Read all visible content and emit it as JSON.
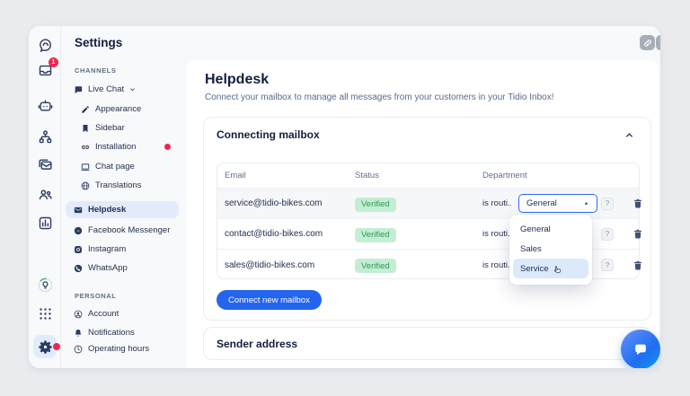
{
  "theme": {
    "accent": "#2465f0",
    "badge_red": "#f3264b",
    "verified_bg": "#c4eed3",
    "verified_text": "#2e9857",
    "selected_bg": "#e2ebfc"
  },
  "rail": {
    "inbox_badge": "1",
    "icons": [
      "tidio-logo",
      "inbox",
      "chatbot",
      "automation",
      "campaigns",
      "contacts",
      "analytics",
      "insights",
      "apps",
      "settings"
    ]
  },
  "sidebar": {
    "title": "Settings",
    "channels_label": "CHANNELS",
    "personal_label": "PERSONAL",
    "items": [
      {
        "label": "Live Chat",
        "icon": "chat-bubble-icon"
      },
      {
        "label": "Appearance",
        "icon": "pencil-icon"
      },
      {
        "label": "Sidebar",
        "icon": "bookmark-icon"
      },
      {
        "label": "Installation",
        "icon": "link-icon",
        "notification_dot": true
      },
      {
        "label": "Chat page",
        "icon": "monitor-icon"
      },
      {
        "label": "Translations",
        "icon": "globe-icon"
      },
      {
        "label": "Helpdesk",
        "icon": "mail-icon",
        "selected": true
      },
      {
        "label": "Facebook Messenger",
        "icon": "messenger-icon"
      },
      {
        "label": "Instagram",
        "icon": "instagram-icon"
      },
      {
        "label": "WhatsApp",
        "icon": "whatsapp-icon"
      },
      {
        "label": "Account",
        "icon": "person-icon"
      },
      {
        "label": "Notifications",
        "icon": "bell-icon"
      },
      {
        "label": "Operating hours",
        "icon": "clock-icon"
      }
    ]
  },
  "main": {
    "title": "Helpdesk",
    "subtitle": "Connect your mailbox to manage all messages from your customers in your Tidio Inbox!",
    "connecting_mailbox": {
      "title": "Connecting mailbox",
      "table": {
        "columns": [
          "Email",
          "Status",
          "Department"
        ],
        "rows": [
          {
            "email": "service@tidio-bikes.com",
            "status": "Verified",
            "routing": "is routi..."
          },
          {
            "email": "contact@tidio-bikes.com",
            "status": "Verified",
            "routing": "is routi..."
          },
          {
            "email": "sales@tidio-bikes.com",
            "status": "Verified",
            "routing": "is routi..."
          }
        ]
      },
      "dropdown": {
        "selected": "General",
        "options": [
          "General",
          "Sales",
          "Service"
        ],
        "highlighted": "Service"
      },
      "help_label": "?",
      "connect_button": "Connect new mailbox"
    },
    "sender_address": {
      "title": "Sender address"
    }
  }
}
